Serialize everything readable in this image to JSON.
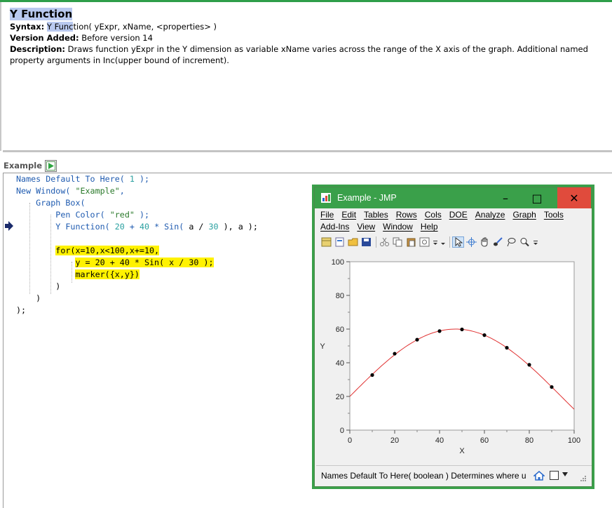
{
  "header": {
    "title": "Y Function",
    "syntax_label": "Syntax:",
    "syntax_fn_highlight": "Y Func",
    "syntax_fn_rest": "tion( yExpr, xName, <properties> )",
    "version_label": "Version Added:",
    "version_value": "Before version 14",
    "description_label": "Description:",
    "description_text": "Draws function yExpr in the Y dimension as variable xName varies across the range of the X axis of the graph. Additional named property arguments in Inc(upper bound of increment)."
  },
  "example": {
    "label": "Example",
    "run_icon": "run-script-icon"
  },
  "code": {
    "l1_a": "Names Default To Here(",
    "l1_b": " 1 ",
    "l1_c": ");",
    "l2_a": "New Window(",
    "l2_b": " \"Example\"",
    "l2_c": ",",
    "l3": "Graph Box(",
    "l4_a": "Pen Color(",
    "l4_b": " \"red\" ",
    "l4_c": ");",
    "l5_a": "Y Function(",
    "l5_b": " 20 ",
    "l5_c": "+",
    "l5_d": " 40 ",
    "l5_e": "*",
    "l5_f": " Sin(",
    "l5_g": " a / ",
    "l5_h": "30",
    "l5_i": " ), a );",
    "l7": "for(x=10,x<100,x+=10,",
    "l8_a": "y = 20 + 40 * Sin(",
    "l8_b": " x / ",
    "l8_c": "30",
    "l8_d": " );",
    "l9": "marker({x,y})",
    "l10": ")",
    "l11": ")",
    "l12": ");"
  },
  "jmp_window": {
    "title": "Example - JMP",
    "minimize": "–",
    "maximize": "□",
    "close": "✕",
    "menu_row1": [
      "File",
      "Edit",
      "Tables",
      "Rows",
      "Cols",
      "DOE",
      "Analyze",
      "Graph",
      "Tools"
    ],
    "menu_row2": [
      "Add-Ins",
      "View",
      "Window",
      "Help"
    ],
    "status_text": "Names Default To Here( boolean ) Determines where u",
    "colors": {
      "titlebar": "#3aa04a",
      "close": "#e04b3c"
    }
  },
  "chart_data": {
    "type": "line",
    "title": "",
    "xlabel": "X",
    "ylabel": "Y",
    "xlim": [
      0,
      100
    ],
    "ylim": [
      0,
      100
    ],
    "x_ticks": [
      "0",
      "20",
      "40",
      "60",
      "80",
      "100"
    ],
    "y_ticks": [
      "0",
      "20",
      "40",
      "60",
      "80",
      "100"
    ],
    "function": "20 + 40 * Sin( x / 30 )",
    "line_color": "#e03030",
    "marker_color": "#000000",
    "markers": {
      "x": [
        10,
        20,
        30,
        40,
        50,
        60,
        70,
        80,
        90
      ],
      "y": [
        32.7,
        45.4,
        53.7,
        58.8,
        59.8,
        56.4,
        48.9,
        38.8,
        25.6
      ]
    }
  }
}
